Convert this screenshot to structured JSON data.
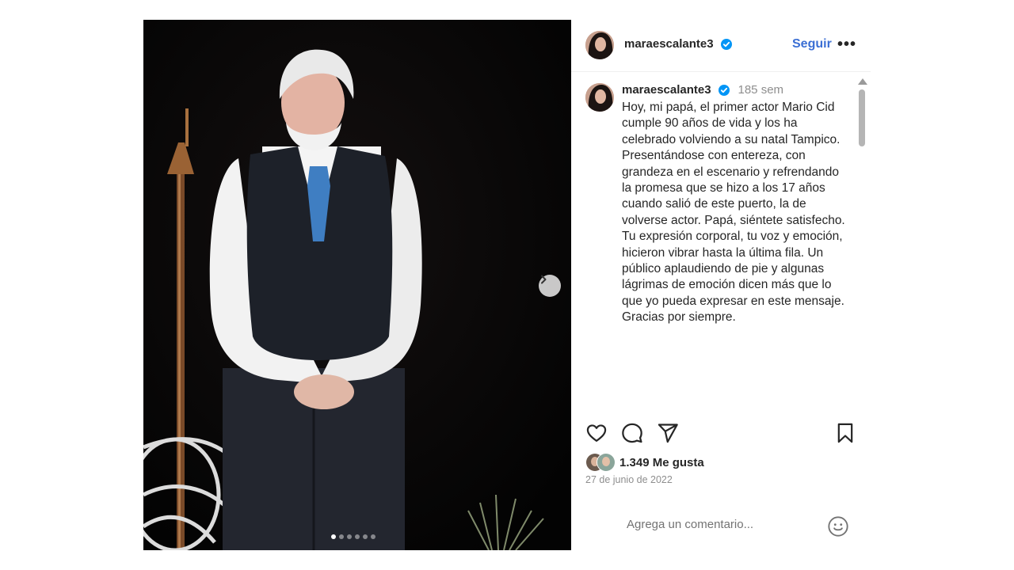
{
  "post": {
    "username": "maraescalante3",
    "verified": true,
    "follow_label": "Seguir",
    "more_label": "•••",
    "carousel": {
      "slide_count": 6,
      "current_index": 0
    }
  },
  "caption": {
    "username": "maraescalante3",
    "time_ago": "185 sem",
    "text": "Hoy, mi papá, el primer actor Mario Cid cumple 90 años de vida y los ha celebrado volviendo a su natal Tampico. Presentándose con entereza, con grandeza en el escenario y refrendando la promesa que se hizo a los 17 años cuando salió de este puerto, la de volverse actor. Papá, siéntete satisfecho. Tu expresión corporal, tu voz y emoción, hicieron vibrar hasta la última fila. Un público aplaudiendo de pie y algunas lágrimas de emoción dicen más que lo que yo pueda expresar en este mensaje. Gracias por siempre."
  },
  "engagement": {
    "likes": "1.349 Me gusta",
    "date": "27 de junio de 2022"
  },
  "comment_box": {
    "placeholder": "Agrega un comentario..."
  },
  "icons": {
    "like": "heart-icon",
    "comment": "comment-icon",
    "share": "send-icon",
    "save": "bookmark-icon",
    "emoji": "smiley-icon",
    "verified": "verified-badge-icon",
    "next": "chevron-right-icon"
  },
  "colors": {
    "link": "#3b6fd4",
    "verified": "#0095f6",
    "muted": "#8e8e8e",
    "text": "#262626"
  }
}
